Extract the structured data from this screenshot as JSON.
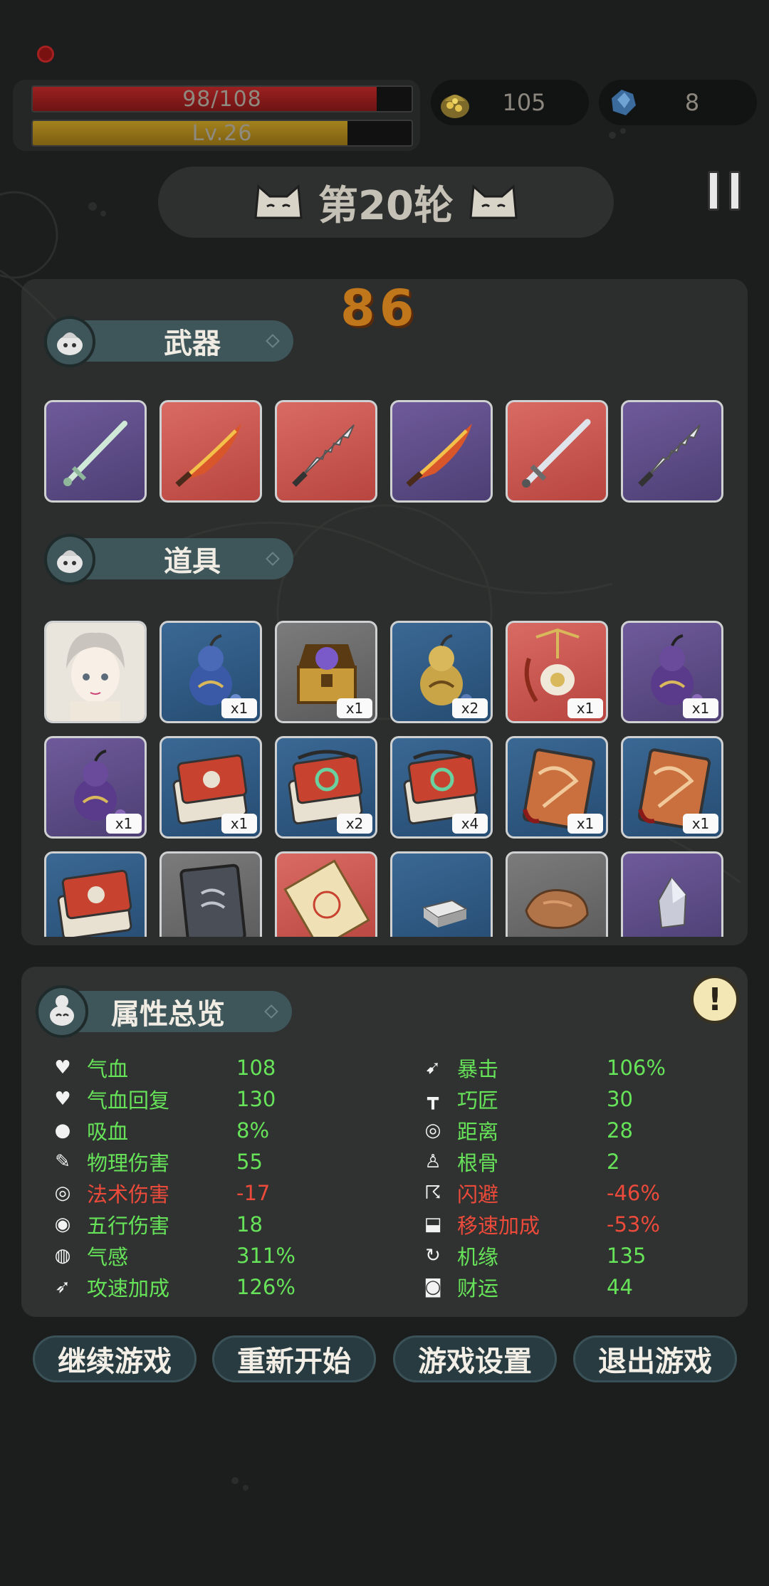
{
  "hud": {
    "hp_text": "98/108",
    "hp_fraction": 0.9074,
    "level_text": "Lv.26",
    "level_fraction": 0.83,
    "coins": "105",
    "gems": "8",
    "coin_icon": "gold-pouch-icon",
    "gem_icon": "blue-crystal-icon"
  },
  "round": {
    "title": "第20轮"
  },
  "combo": "86",
  "weapons": {
    "title": "武器",
    "slots": [
      {
        "rarity": "purple",
        "icon": "jade-sword-icon"
      },
      {
        "rarity": "red",
        "icon": "flame-saber-icon"
      },
      {
        "rarity": "red",
        "icon": "jagged-sword-icon"
      },
      {
        "rarity": "purple",
        "icon": "flame-saber-icon"
      },
      {
        "rarity": "red",
        "icon": "long-sword-icon"
      },
      {
        "rarity": "purple",
        "icon": "jagged-sword-icon"
      }
    ]
  },
  "items": {
    "title": "道具",
    "slots": [
      {
        "rarity": "gray",
        "icon": "character-portrait-icon",
        "qty": ""
      },
      {
        "rarity": "blue",
        "icon": "blue-gourd-icon",
        "qty": "x1"
      },
      {
        "rarity": "gray",
        "icon": "treasure-chest-icon",
        "qty": "x1"
      },
      {
        "rarity": "blue",
        "icon": "golden-gourd-icon",
        "qty": "x2"
      },
      {
        "rarity": "red",
        "icon": "incense-burner-icon",
        "qty": "x1"
      },
      {
        "rarity": "purple",
        "icon": "purple-gourd-icon",
        "qty": "x1"
      },
      {
        "rarity": "purple",
        "icon": "purple-gourd-icon",
        "qty": "x1"
      },
      {
        "rarity": "blue",
        "icon": "red-scripture-icon",
        "qty": "x1"
      },
      {
        "rarity": "blue",
        "icon": "jade-scripture-icon",
        "qty": "x2"
      },
      {
        "rarity": "blue",
        "icon": "jade-scripture-icon",
        "qty": "x4"
      },
      {
        "rarity": "blue",
        "icon": "dragon-tome-icon",
        "qty": "x1"
      },
      {
        "rarity": "blue",
        "icon": "dragon-tome-icon",
        "qty": "x1"
      },
      {
        "rarity": "blue",
        "icon": "red-scripture-icon",
        "qty": ""
      },
      {
        "rarity": "gray",
        "icon": "gray-tome-icon",
        "qty": ""
      },
      {
        "rarity": "red",
        "icon": "scroll-map-icon",
        "qty": ""
      },
      {
        "rarity": "blue",
        "icon": "iron-ingot-icon",
        "qty": ""
      },
      {
        "rarity": "gray",
        "icon": "copper-ore-icon",
        "qty": ""
      },
      {
        "rarity": "purple",
        "icon": "crystal-shard-icon",
        "qty": ""
      }
    ]
  },
  "stats": {
    "title": "属性总览",
    "info_symbol": "!",
    "left": [
      {
        "icon": "heart-icon",
        "name": "气血",
        "value": "108",
        "tone": "pos"
      },
      {
        "icon": "heart-regen-icon",
        "name": "气血回复",
        "value": "130",
        "tone": "pos"
      },
      {
        "icon": "blood-drop-icon",
        "name": "吸血",
        "value": "8%",
        "tone": "pos"
      },
      {
        "icon": "sword-icon",
        "name": "物理伤害",
        "value": "55",
        "tone": "pos"
      },
      {
        "icon": "spiral-icon",
        "name": "法术伤害",
        "value": "-17",
        "tone": "neg"
      },
      {
        "icon": "five-elements-icon",
        "name": "五行伤害",
        "value": "18",
        "tone": "pos"
      },
      {
        "icon": "qi-sense-icon",
        "name": "气感",
        "value": "311%",
        "tone": "pos"
      },
      {
        "icon": "attack-speed-icon",
        "name": "攻速加成",
        "value": "126%",
        "tone": "pos"
      }
    ],
    "right": [
      {
        "icon": "crit-bow-icon",
        "name": "暴击",
        "value": "106%",
        "tone": "pos"
      },
      {
        "icon": "hammer-icon",
        "name": "巧匠",
        "value": "30",
        "tone": "pos"
      },
      {
        "icon": "range-target-icon",
        "name": "距离",
        "value": "28",
        "tone": "pos"
      },
      {
        "icon": "meditation-icon",
        "name": "根骨",
        "value": "2",
        "tone": "pos"
      },
      {
        "icon": "dodge-runner-icon",
        "name": "闪避",
        "value": "-46%",
        "tone": "neg"
      },
      {
        "icon": "speed-boot-icon",
        "name": "移速加成",
        "value": "-53%",
        "tone": "neg"
      },
      {
        "icon": "fortune-cycle-icon",
        "name": "机缘",
        "value": "135",
        "tone": "pos"
      },
      {
        "icon": "coin-icon",
        "name": "财运",
        "value": "44",
        "tone": "pos"
      }
    ]
  },
  "menu": {
    "continue": "继续游戏",
    "restart": "重新开始",
    "settings": "游戏设置",
    "exit": "退出游戏"
  },
  "colors": {
    "positive": "#67e35a",
    "negative": "#ec4a3a",
    "tab": "#3e5559",
    "background": "#1b1e1d"
  }
}
